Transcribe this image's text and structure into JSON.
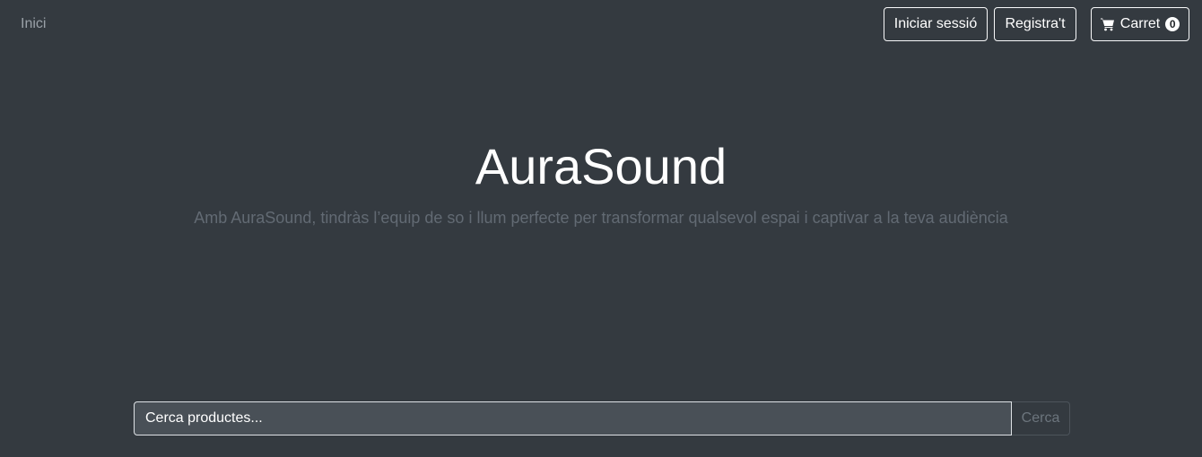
{
  "nav": {
    "home_label": "Inici",
    "login_label": "Iniciar sessió",
    "register_label": "Registra't",
    "cart_label": "Carret",
    "cart_count": "0",
    "cart_icon": "shopping-cart-icon"
  },
  "hero": {
    "title": "AuraSound",
    "subtitle": "Amb AuraSound, tindràs l’equip de so i llum perfecte per transformar qualsevol espai i captivar a la teva audiència"
  },
  "search": {
    "placeholder": "Cerca productes...",
    "value": "",
    "button_label": "Cerca"
  },
  "colors": {
    "background": "#343a40",
    "subtitle": "#626a73",
    "input_background": "#495057"
  }
}
